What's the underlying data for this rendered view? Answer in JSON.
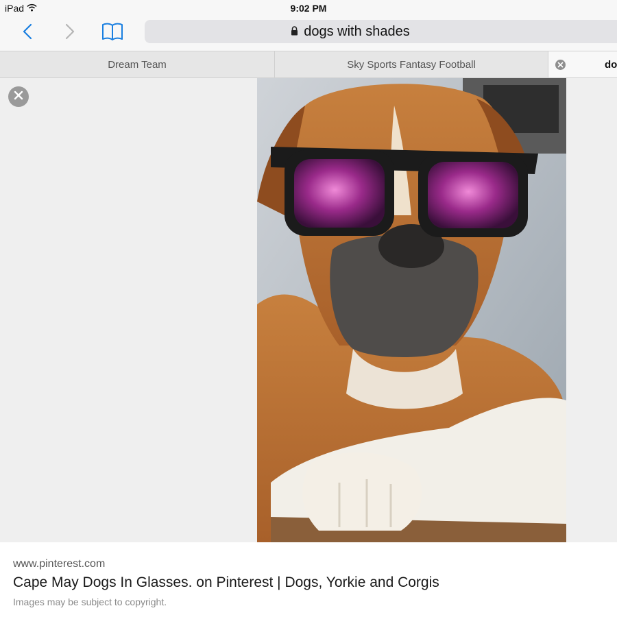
{
  "status_bar": {
    "device": "iPad",
    "time": "9:02 PM",
    "wifi_icon": "wifi-icon"
  },
  "toolbar": {
    "back_icon": "chevron-left-icon",
    "forward_icon": "chevron-right-icon",
    "bookmarks_icon": "book-icon",
    "address": "dogs with shades",
    "lock_icon": "lock-icon",
    "accent_color": "#1a7fe0"
  },
  "tabs": [
    {
      "label": "Dream Team"
    },
    {
      "label": "Sky Sports Fantasy Football"
    },
    {
      "label": "do",
      "active": true
    }
  ],
  "viewer": {
    "close_icon": "close-icon",
    "image_subject": "boxer dog wearing sunglasses"
  },
  "caption": {
    "domain": "www.pinterest.com",
    "title": "Cape May Dogs In Glasses. on Pinterest | Dogs, Yorkie and Corgis",
    "note": "Images may be subject to copyright."
  }
}
